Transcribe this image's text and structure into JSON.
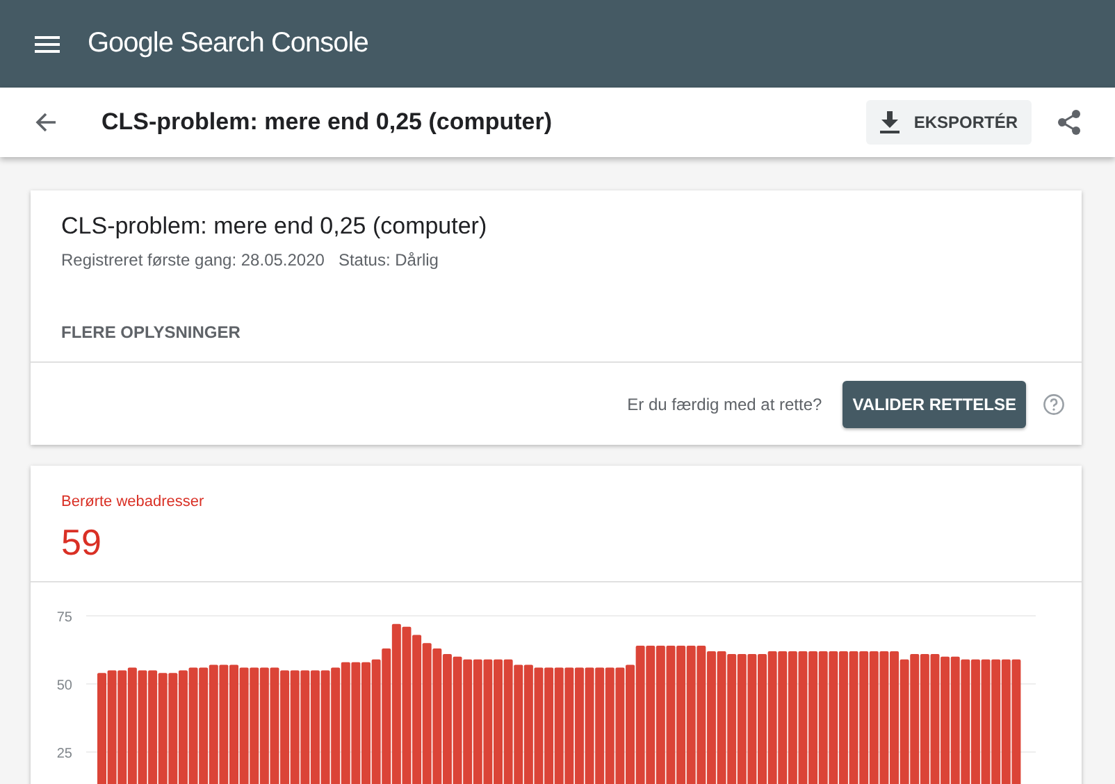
{
  "app_bar": {
    "title": "Google Search Console"
  },
  "page_header": {
    "title": "CLS-problem: mere end 0,25 (computer)",
    "export_button": "EKSPORTÉR"
  },
  "issue_card": {
    "title": "CLS-problem: mere end 0,25 (computer)",
    "first_detected": "Registreret første gang: 28.05.2020",
    "status": "Status: Dårlig",
    "more_info": "FLERE OPLYSNINGER",
    "prompt": "Er du færdig med at rette?",
    "validate_button": "VALIDER RETTELSE"
  },
  "affected_card": {
    "label": "Berørte webadresser",
    "count": "59",
    "chart_data": {
      "type": "bar",
      "ylim": [
        0,
        75
      ],
      "yticks": [
        25,
        50,
        75
      ],
      "series": [
        {
          "color": "#db4437",
          "values": [
            54,
            55,
            55,
            56,
            55,
            55,
            54,
            54,
            55,
            56,
            56,
            57,
            57,
            57,
            56,
            56,
            56,
            56,
            55,
            55,
            55,
            55,
            55,
            56,
            58,
            58,
            58,
            59,
            63,
            72,
            71,
            68,
            65,
            63,
            61,
            60,
            59,
            59,
            59,
            59,
            59,
            57,
            57,
            56,
            56,
            56,
            56,
            56,
            56,
            56,
            56,
            56,
            57,
            64,
            64,
            64,
            64,
            64,
            64,
            64,
            62,
            62,
            61,
            61,
            61,
            61,
            62,
            62,
            62,
            62,
            62,
            62,
            62,
            62,
            62,
            62,
            62,
            62,
            62,
            59,
            61,
            61,
            61,
            60,
            60,
            59,
            59,
            59,
            59,
            59,
            59
          ]
        }
      ]
    }
  }
}
